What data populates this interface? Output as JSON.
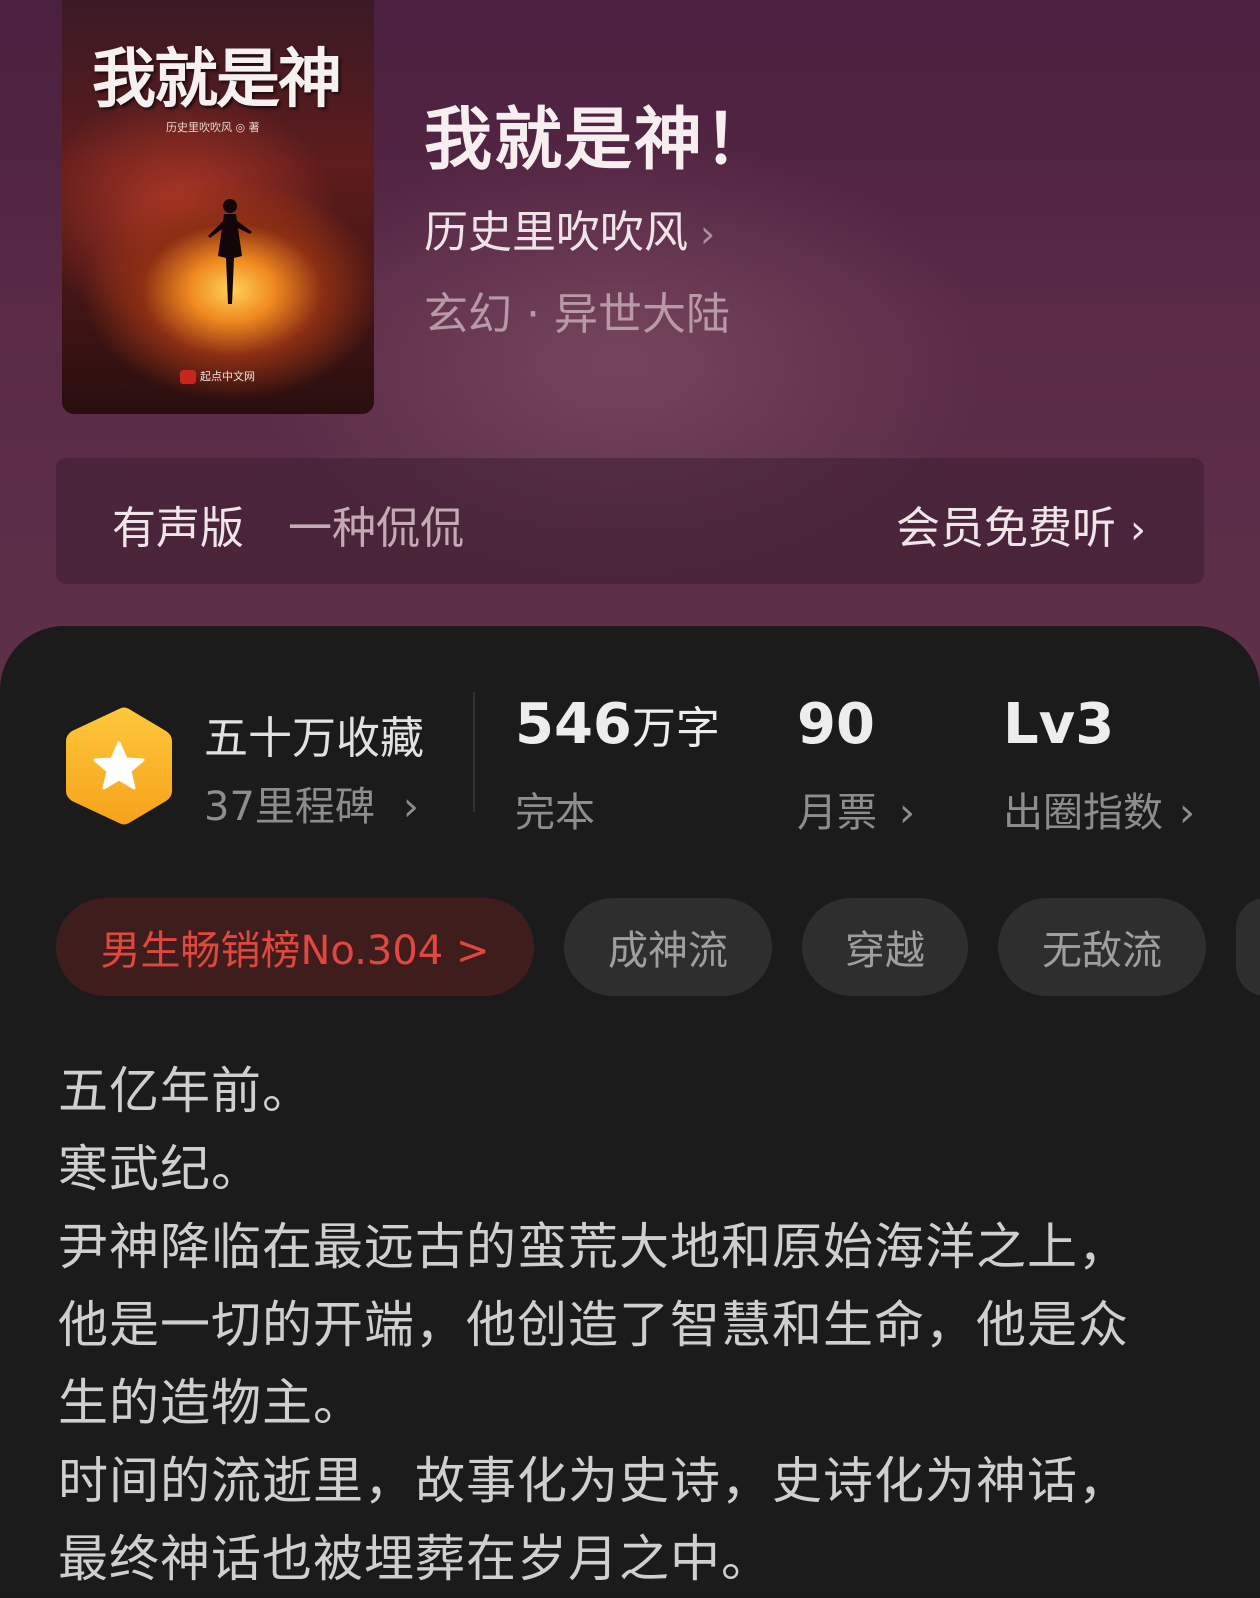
{
  "book": {
    "title": "我就是神！",
    "author": "历史里吹吹风",
    "genre": "玄幻 · 异世大陆",
    "cover": {
      "title": "我就是神",
      "author": "历史里吹吹风 ◎ 著",
      "publisher": "起点中文网"
    }
  },
  "audio": {
    "label": "有声版",
    "narrator": "一种侃侃",
    "action": "会员免费听"
  },
  "stats": {
    "collect_main": "五十万收藏",
    "collect_sub": "37里程碑",
    "words_num": "546",
    "words_unit": "万字",
    "status": "完本",
    "monthly_num": "90",
    "monthly_label": "月票",
    "level": "Lv3",
    "level_label": "出圈指数"
  },
  "tags": [
    "男生畅销榜No.304 >",
    "成神流",
    "穿越",
    "无敌流"
  ],
  "description": [
    "五亿年前。",
    "寒武纪。",
    "尹神降临在最远古的蛮荒大地和原始海洋之上，",
    "他是一切的开端，他创造了智慧和生命，他是众",
    "生的造物主。",
    "时间的流逝里，故事化为史诗，史诗化为神话，",
    "最终神话也被埋葬在岁月之中。"
  ],
  "icons": {
    "author_chevron": "chevron-right-icon",
    "badge": "star-hexagon-icon"
  },
  "colors": {
    "accent_red": "#e0473f",
    "badge_orange": "#fbb52a",
    "hero_purple": "#5a2a47"
  }
}
